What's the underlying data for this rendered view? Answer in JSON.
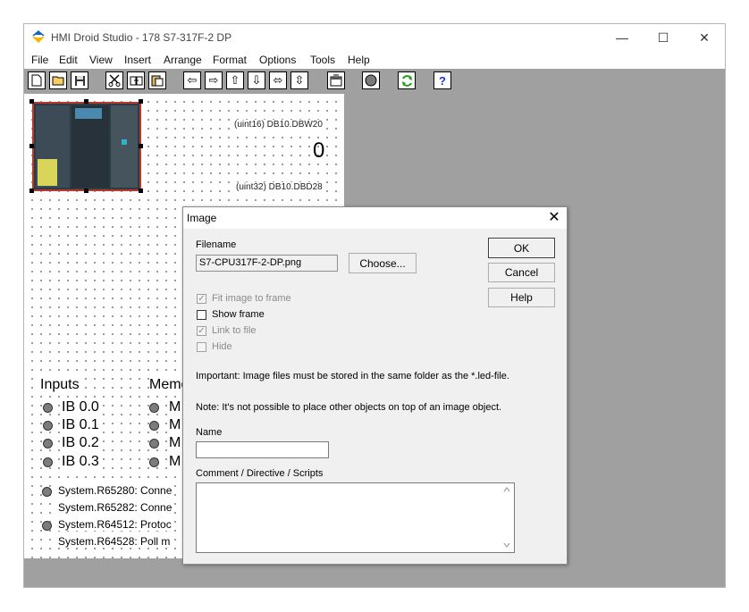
{
  "window": {
    "title": "HMI Droid Studio - 178 S7-317F-2 DP",
    "controls": {
      "minimize": "—",
      "maximize": "☐",
      "close": "✕"
    }
  },
  "menu": [
    "File",
    "Edit",
    "View",
    "Insert",
    "Arrange",
    "Format",
    "Options",
    "Tools",
    "Help"
  ],
  "toolbar": {
    "icons": [
      "new-file",
      "open-folder",
      "save-disk",
      "cut-scissors",
      "paste-clip",
      "copy-clip",
      "align-left-arrow",
      "align-right-arrow",
      "align-top-arrow",
      "align-bottom-arrow",
      "same-width-arrows",
      "same-height-arrows",
      "properties",
      "run-circle",
      "reload",
      "help"
    ],
    "help_label": "?"
  },
  "canvas": {
    "tag1": "(uint16) DB10.DBW20",
    "value1": "0",
    "tag2": "(uint32) DB10.DBD28",
    "inputs_header": "Inputs",
    "memory_header": "Memo",
    "inputs": [
      "IB 0.0",
      "IB 0.1",
      "IB 0.2",
      "IB 0.3"
    ],
    "memory": [
      "M",
      "M",
      "M",
      "M"
    ],
    "system": [
      "System.R65280: Conne",
      "System.R65282: Conne",
      "System.R64512: Protoc",
      "System.R64528: Poll m"
    ]
  },
  "dialog": {
    "title": "Image",
    "close": "✕",
    "filename_label": "Filename",
    "filename_value": "S7-CPU317F-2-DP.png",
    "choose_button": "Choose...",
    "ok_button": "OK",
    "cancel_button": "Cancel",
    "help_button": "Help",
    "checkboxes": {
      "fit": "Fit image to frame",
      "show_frame": "Show frame",
      "link": "Link to file",
      "hide": "Hide"
    },
    "note1": "Important: Image files must be stored in the same folder as the *.led-file.",
    "note2": "Note: It's not possible to place other objects on top of an image object.",
    "name_label": "Name",
    "name_value": "",
    "comment_label": "Comment / Directive / Scripts",
    "comment_value": ""
  },
  "colors": {
    "workspace": "#a0a0a0",
    "dialog": "#f0f0f0",
    "plc_frame": "#c0392b"
  }
}
